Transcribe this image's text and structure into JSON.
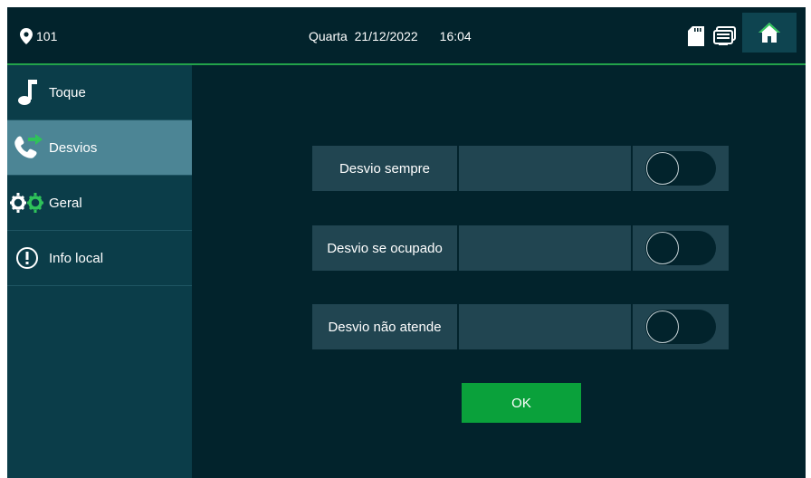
{
  "header": {
    "room_number": "101",
    "weekday": "Quarta",
    "date": "21/12/2022",
    "time": "16:04"
  },
  "sidebar": {
    "items": [
      {
        "label": "Toque",
        "icon": "music-note-icon"
      },
      {
        "label": "Desvios",
        "icon": "phone-forward-icon"
      },
      {
        "label": "Geral",
        "icon": "gears-icon"
      },
      {
        "label": "Info local",
        "icon": "info-icon"
      }
    ],
    "active_index": 1
  },
  "main": {
    "rows": [
      {
        "label": "Desvio sempre",
        "value": "",
        "enabled": false
      },
      {
        "label": "Desvio se ocupado",
        "value": "",
        "enabled": false
      },
      {
        "label": "Desvio não atende",
        "value": "",
        "enabled": false
      }
    ],
    "ok_label": "OK"
  },
  "colors": {
    "background": "#02232c",
    "sidebar": "#0b3d49",
    "sidebar_active": "#4c8595",
    "row": "#214551",
    "accent_green": "#0aa13b",
    "divider_green": "#22a24a"
  }
}
